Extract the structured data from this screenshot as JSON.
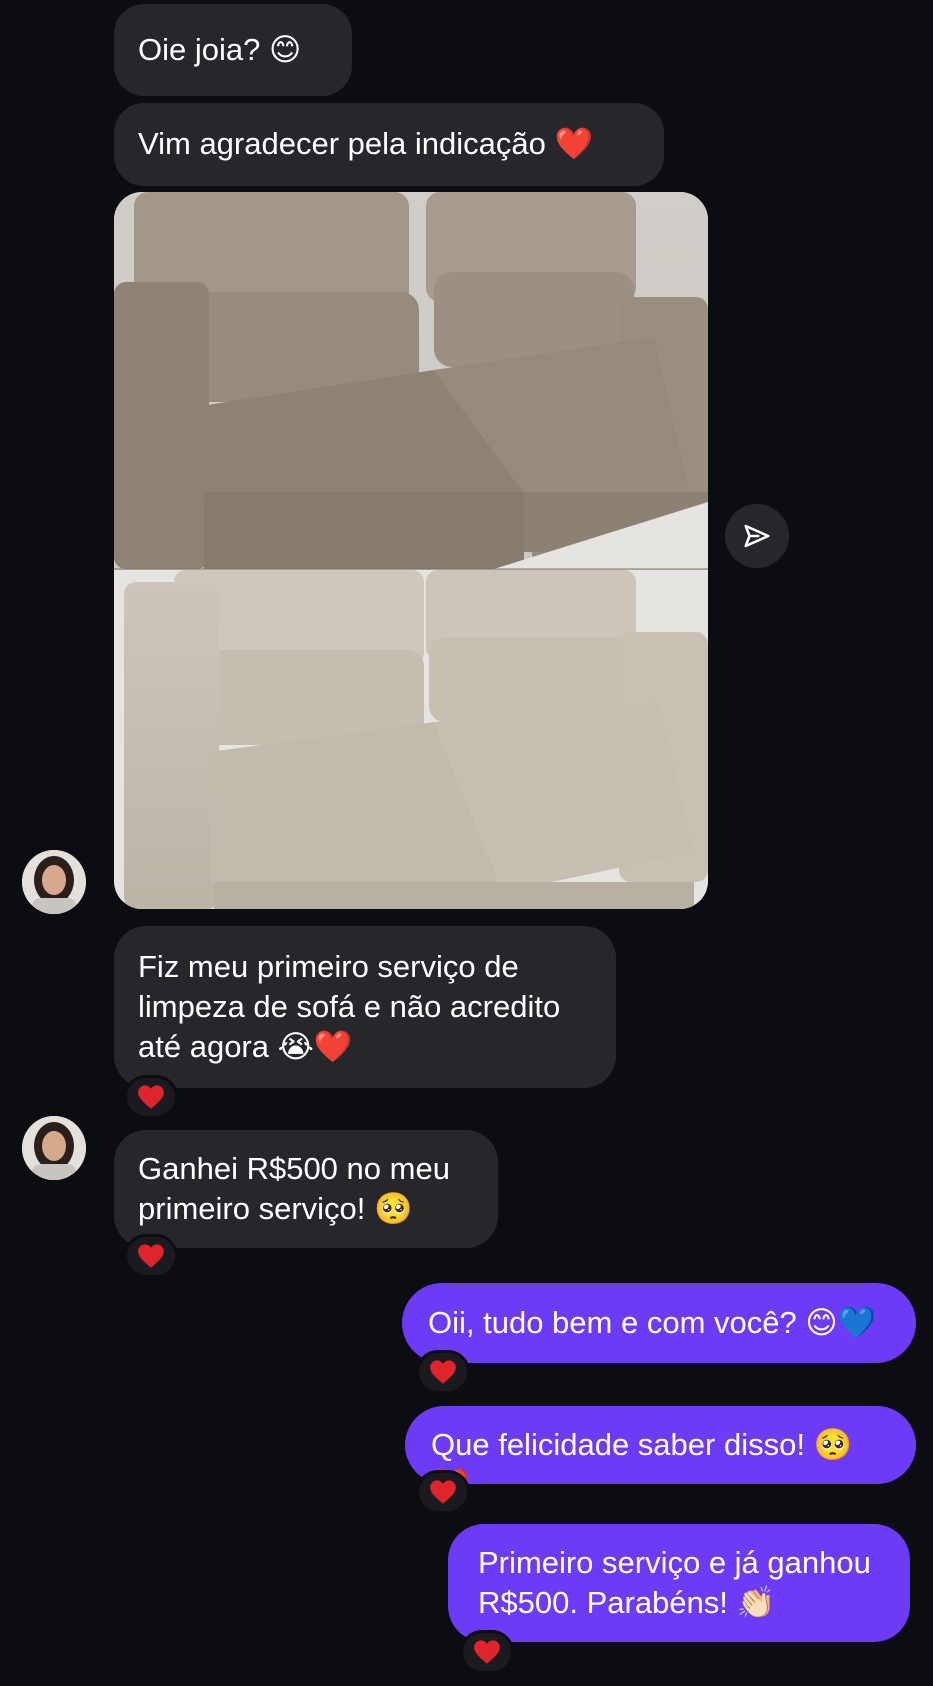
{
  "messages": {
    "m1": "Oie joia? 😊",
    "m2": "Vim agradecer pela indicação ❤️",
    "m3_line1": "Fiz meu primeiro serviço de",
    "m3_line2": "limpeza de sofá e não acredito",
    "m3_line3": "até agora 😭❤️",
    "m4_line1": "Ganhei R$500 no meu",
    "m4_line2": "primeiro serviço! 🥺",
    "m5": "Oii, tudo bem e com você? 😊💙",
    "m6": "Que felicidade saber disso! 🥺❤️",
    "m7_line1": "Primeiro serviço e já ganhou",
    "m7_line2": "R$500. Parabéns! 👏🏻"
  },
  "icons": {
    "reaction": "heart-icon",
    "share": "send-icon",
    "avatar": "contact-avatar"
  },
  "colors": {
    "background": "#0b0d12",
    "incoming_bubble": "#26272c",
    "outgoing_bubble": "#6d3bf5",
    "reaction_heart": "#e0242b"
  }
}
